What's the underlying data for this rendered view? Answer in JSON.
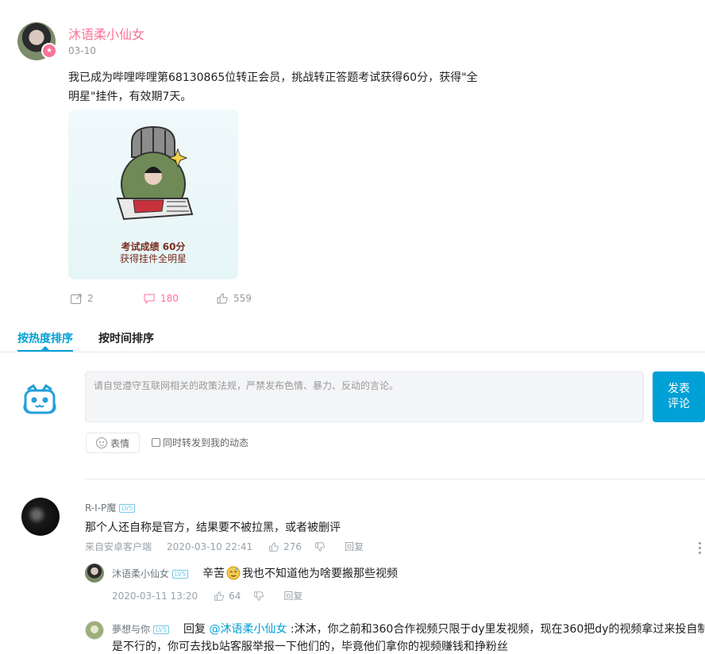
{
  "post": {
    "username": "沐语柔小仙女",
    "date": "03-10",
    "text_line1": "我已成为哔哩哔哩第68130865位转正会员，挑战转正答题考试获得60分，获得\"全",
    "text_line2": "明星\"挂件，有效期7天。",
    "card": {
      "caption_score": "考试成绩 60分",
      "caption_reward": "获得挂件全明星"
    },
    "forward_count": "2",
    "comment_count": "180",
    "like_count": "559"
  },
  "tabs": {
    "hot": "按热度排序",
    "time": "按时间排序"
  },
  "composer": {
    "placeholder": "请自觉遵守互联网相关的政策法规，严禁发布色情、暴力、反动的言论。",
    "send_line1": "发表",
    "send_line2": "评论",
    "emoji_label": "表情",
    "forward_label": "同时转发到我的动态"
  },
  "comments": [
    {
      "user": "R-I-P魔",
      "level": "LV5",
      "text": "那个人还自称是官方，结果要不被拉黑，或者被删评",
      "source": "来自安卓客户端",
      "time": "2020-03-10 22:41",
      "likes": "276",
      "reply_label": "回复",
      "replies": [
        {
          "user": "沐语柔小仙女",
          "level": "LV5",
          "text_a": "辛苦",
          "text_b": "我也不知道他为啥要搬那些视频",
          "time": "2020-03-11 13:20",
          "likes": "64",
          "reply_label": "回复"
        },
        {
          "user": "夢想与你",
          "level": "LV5",
          "reply_word": "回复",
          "mention": "@沐语柔小仙女",
          "text_line1": ":沐沐，你之前和360合作视频只限于dy里发视频，现在360把dy的视频拿过来投自制",
          "text_line2": "是不行的，你可去找b站客服举报一下他们的，毕竟他们拿你的视频赚钱和挣粉丝"
        }
      ]
    }
  ],
  "colors": {
    "accent": "#00a1d6",
    "pink": "#fb7299",
    "muted": "#99a2aa"
  }
}
